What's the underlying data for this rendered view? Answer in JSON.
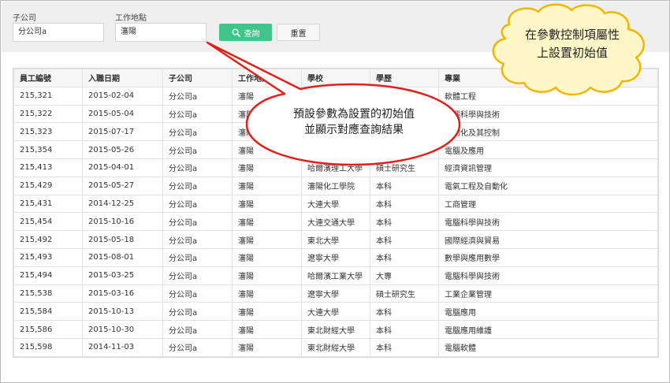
{
  "filters": {
    "company_label": "子公司",
    "company_value": "分公司a",
    "location_label": "工作地點",
    "location_value": "瀋陽",
    "query_label": "查詢",
    "reset_label": "重置"
  },
  "table": {
    "columns": [
      "員工編號",
      "入職日期",
      "子公司",
      "工作地點",
      "學校",
      "學歷",
      "專業"
    ],
    "rows": [
      [
        "215,321",
        "2015-02-04",
        "分公司a",
        "瀋陽",
        "",
        "",
        "軟體工程"
      ],
      [
        "215,322",
        "2015-05-04",
        "分公司a",
        "瀋陽",
        "",
        "",
        "電腦科學與技術"
      ],
      [
        "215,323",
        "2015-07-17",
        "分公司a",
        "瀋陽",
        "",
        "",
        "自動化及其控制"
      ],
      [
        "215,354",
        "2015-05-26",
        "分公司a",
        "瀋陽",
        "",
        "",
        "電腦及應用"
      ],
      [
        "215,413",
        "2015-04-01",
        "分公司a",
        "瀋陽",
        "哈爾濱理工大學",
        "碩士研究生",
        "經濟資訊管理"
      ],
      [
        "215,429",
        "2015-05-27",
        "分公司a",
        "瀋陽",
        "瀋陽化工學院",
        "本科",
        "電氣工程及自動化"
      ],
      [
        "215,431",
        "2014-12-25",
        "分公司a",
        "瀋陽",
        "大連大學",
        "本科",
        "工商管理"
      ],
      [
        "215,454",
        "2015-10-16",
        "分公司a",
        "瀋陽",
        "大連交通大學",
        "本科",
        "電腦科學與技術"
      ],
      [
        "215,492",
        "2015-05-18",
        "分公司a",
        "瀋陽",
        "東北大學",
        "本科",
        "國際經濟與貿易"
      ],
      [
        "215,493",
        "2015-08-01",
        "分公司a",
        "瀋陽",
        "遼寧大學",
        "本科",
        "數學與應用數學"
      ],
      [
        "215,494",
        "2015-03-25",
        "分公司a",
        "瀋陽",
        "哈爾濱工業大學",
        "大專",
        "電腦科學與技術"
      ],
      [
        "215,538",
        "2015-03-16",
        "分公司a",
        "瀋陽",
        "遼寧大學",
        "碩士研究生",
        "工業企業管理"
      ],
      [
        "215,584",
        "2015-10-13",
        "分公司a",
        "瀋陽",
        "大連大學",
        "本科",
        "電腦應用"
      ],
      [
        "215,586",
        "2015-10-30",
        "分公司a",
        "瀋陽",
        "東北財經大學",
        "本科",
        "電腦應用維護"
      ],
      [
        "215,598",
        "2014-11-03",
        "分公司a",
        "瀋陽",
        "東北財經大學",
        "本科",
        "電腦軟體"
      ]
    ]
  },
  "annotations": {
    "speech_line1": "預設參數為設置的初始值",
    "speech_line2": "並顯示對應查詢結果",
    "cloud_line1": "在參數控制項屬性",
    "cloud_line2": "上設置初始值"
  },
  "colors": {
    "accent_green": "#3fc48c",
    "header_bg": "#f5f5f5",
    "filter_bg": "#efefef",
    "cloud_fill": "#fff7c7",
    "cloud_stroke": "#f2b600",
    "bubble_stroke": "#e0201b"
  }
}
